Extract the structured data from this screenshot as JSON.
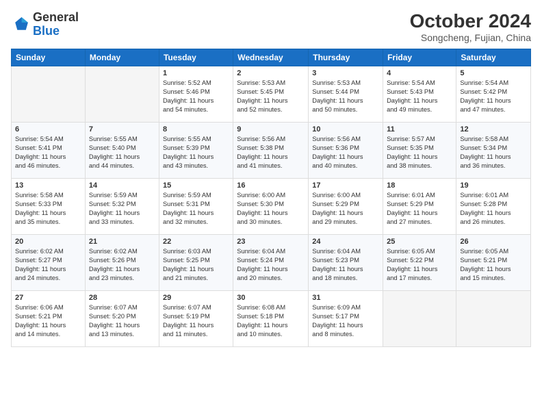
{
  "header": {
    "logo_general": "General",
    "logo_blue": "Blue",
    "month_title": "October 2024",
    "subtitle": "Songcheng, Fujian, China"
  },
  "weekdays": [
    "Sunday",
    "Monday",
    "Tuesday",
    "Wednesday",
    "Thursday",
    "Friday",
    "Saturday"
  ],
  "weeks": [
    [
      {
        "day": "",
        "info": ""
      },
      {
        "day": "",
        "info": ""
      },
      {
        "day": "1",
        "info": "Sunrise: 5:52 AM\nSunset: 5:46 PM\nDaylight: 11 hours\nand 54 minutes."
      },
      {
        "day": "2",
        "info": "Sunrise: 5:53 AM\nSunset: 5:45 PM\nDaylight: 11 hours\nand 52 minutes."
      },
      {
        "day": "3",
        "info": "Sunrise: 5:53 AM\nSunset: 5:44 PM\nDaylight: 11 hours\nand 50 minutes."
      },
      {
        "day": "4",
        "info": "Sunrise: 5:54 AM\nSunset: 5:43 PM\nDaylight: 11 hours\nand 49 minutes."
      },
      {
        "day": "5",
        "info": "Sunrise: 5:54 AM\nSunset: 5:42 PM\nDaylight: 11 hours\nand 47 minutes."
      }
    ],
    [
      {
        "day": "6",
        "info": "Sunrise: 5:54 AM\nSunset: 5:41 PM\nDaylight: 11 hours\nand 46 minutes."
      },
      {
        "day": "7",
        "info": "Sunrise: 5:55 AM\nSunset: 5:40 PM\nDaylight: 11 hours\nand 44 minutes."
      },
      {
        "day": "8",
        "info": "Sunrise: 5:55 AM\nSunset: 5:39 PM\nDaylight: 11 hours\nand 43 minutes."
      },
      {
        "day": "9",
        "info": "Sunrise: 5:56 AM\nSunset: 5:38 PM\nDaylight: 11 hours\nand 41 minutes."
      },
      {
        "day": "10",
        "info": "Sunrise: 5:56 AM\nSunset: 5:36 PM\nDaylight: 11 hours\nand 40 minutes."
      },
      {
        "day": "11",
        "info": "Sunrise: 5:57 AM\nSunset: 5:35 PM\nDaylight: 11 hours\nand 38 minutes."
      },
      {
        "day": "12",
        "info": "Sunrise: 5:58 AM\nSunset: 5:34 PM\nDaylight: 11 hours\nand 36 minutes."
      }
    ],
    [
      {
        "day": "13",
        "info": "Sunrise: 5:58 AM\nSunset: 5:33 PM\nDaylight: 11 hours\nand 35 minutes."
      },
      {
        "day": "14",
        "info": "Sunrise: 5:59 AM\nSunset: 5:32 PM\nDaylight: 11 hours\nand 33 minutes."
      },
      {
        "day": "15",
        "info": "Sunrise: 5:59 AM\nSunset: 5:31 PM\nDaylight: 11 hours\nand 32 minutes."
      },
      {
        "day": "16",
        "info": "Sunrise: 6:00 AM\nSunset: 5:30 PM\nDaylight: 11 hours\nand 30 minutes."
      },
      {
        "day": "17",
        "info": "Sunrise: 6:00 AM\nSunset: 5:29 PM\nDaylight: 11 hours\nand 29 minutes."
      },
      {
        "day": "18",
        "info": "Sunrise: 6:01 AM\nSunset: 5:29 PM\nDaylight: 11 hours\nand 27 minutes."
      },
      {
        "day": "19",
        "info": "Sunrise: 6:01 AM\nSunset: 5:28 PM\nDaylight: 11 hours\nand 26 minutes."
      }
    ],
    [
      {
        "day": "20",
        "info": "Sunrise: 6:02 AM\nSunset: 5:27 PM\nDaylight: 11 hours\nand 24 minutes."
      },
      {
        "day": "21",
        "info": "Sunrise: 6:02 AM\nSunset: 5:26 PM\nDaylight: 11 hours\nand 23 minutes."
      },
      {
        "day": "22",
        "info": "Sunrise: 6:03 AM\nSunset: 5:25 PM\nDaylight: 11 hours\nand 21 minutes."
      },
      {
        "day": "23",
        "info": "Sunrise: 6:04 AM\nSunset: 5:24 PM\nDaylight: 11 hours\nand 20 minutes."
      },
      {
        "day": "24",
        "info": "Sunrise: 6:04 AM\nSunset: 5:23 PM\nDaylight: 11 hours\nand 18 minutes."
      },
      {
        "day": "25",
        "info": "Sunrise: 6:05 AM\nSunset: 5:22 PM\nDaylight: 11 hours\nand 17 minutes."
      },
      {
        "day": "26",
        "info": "Sunrise: 6:05 AM\nSunset: 5:21 PM\nDaylight: 11 hours\nand 15 minutes."
      }
    ],
    [
      {
        "day": "27",
        "info": "Sunrise: 6:06 AM\nSunset: 5:21 PM\nDaylight: 11 hours\nand 14 minutes."
      },
      {
        "day": "28",
        "info": "Sunrise: 6:07 AM\nSunset: 5:20 PM\nDaylight: 11 hours\nand 13 minutes."
      },
      {
        "day": "29",
        "info": "Sunrise: 6:07 AM\nSunset: 5:19 PM\nDaylight: 11 hours\nand 11 minutes."
      },
      {
        "day": "30",
        "info": "Sunrise: 6:08 AM\nSunset: 5:18 PM\nDaylight: 11 hours\nand 10 minutes."
      },
      {
        "day": "31",
        "info": "Sunrise: 6:09 AM\nSunset: 5:17 PM\nDaylight: 11 hours\nand 8 minutes."
      },
      {
        "day": "",
        "info": ""
      },
      {
        "day": "",
        "info": ""
      }
    ]
  ]
}
